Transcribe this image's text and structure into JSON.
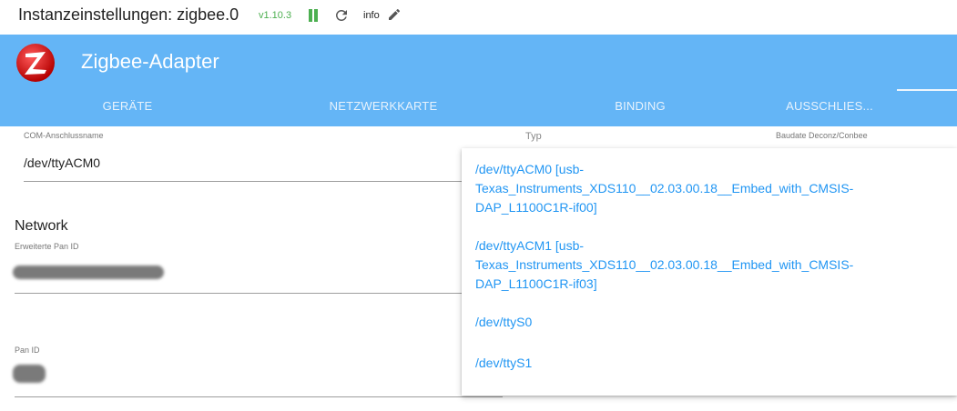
{
  "titlebar": {
    "title": "Instanzeinstellungen: zigbee.0",
    "version": "v1.10.3",
    "info_label": "info",
    "icons": [
      "pause-icon",
      "reload-icon",
      "edit-icon"
    ],
    "status_color": "#4caf50"
  },
  "header": {
    "title": "Zigbee-Adapter",
    "background": "#64b5f6",
    "tabs": [
      {
        "label": "GERÄTE"
      },
      {
        "label": "NETZWERKKARTE"
      },
      {
        "label": "BINDING"
      },
      {
        "label": "AUSSCHLIES..."
      }
    ]
  },
  "form": {
    "com_label": "COM-Anschlussname",
    "com_value": "/dev/ttyACM0",
    "type_label": "Typ",
    "baud_label": "Baudate Deconz/Conbee",
    "network_title": "Network",
    "ext_pan_label": "Erweiterte Pan ID",
    "pan_label": "Pan ID"
  },
  "dropdown": {
    "link_color": "#2196f3",
    "options": [
      {
        "lines": [
          "/dev/ttyACM0 [usb-",
          "Texas_Instruments_XDS110__02.03.00.18__Embed_with_CMSIS-",
          "DAP_L1100C1R-if00]"
        ]
      },
      {
        "lines": [
          "/dev/ttyACM1 [usb-",
          "Texas_Instruments_XDS110__02.03.00.18__Embed_with_CMSIS-",
          "DAP_L1100C1R-if03]"
        ]
      },
      {
        "lines": [
          "/dev/ttyS0"
        ]
      },
      {
        "lines": [
          "/dev/ttyS1"
        ]
      }
    ]
  }
}
